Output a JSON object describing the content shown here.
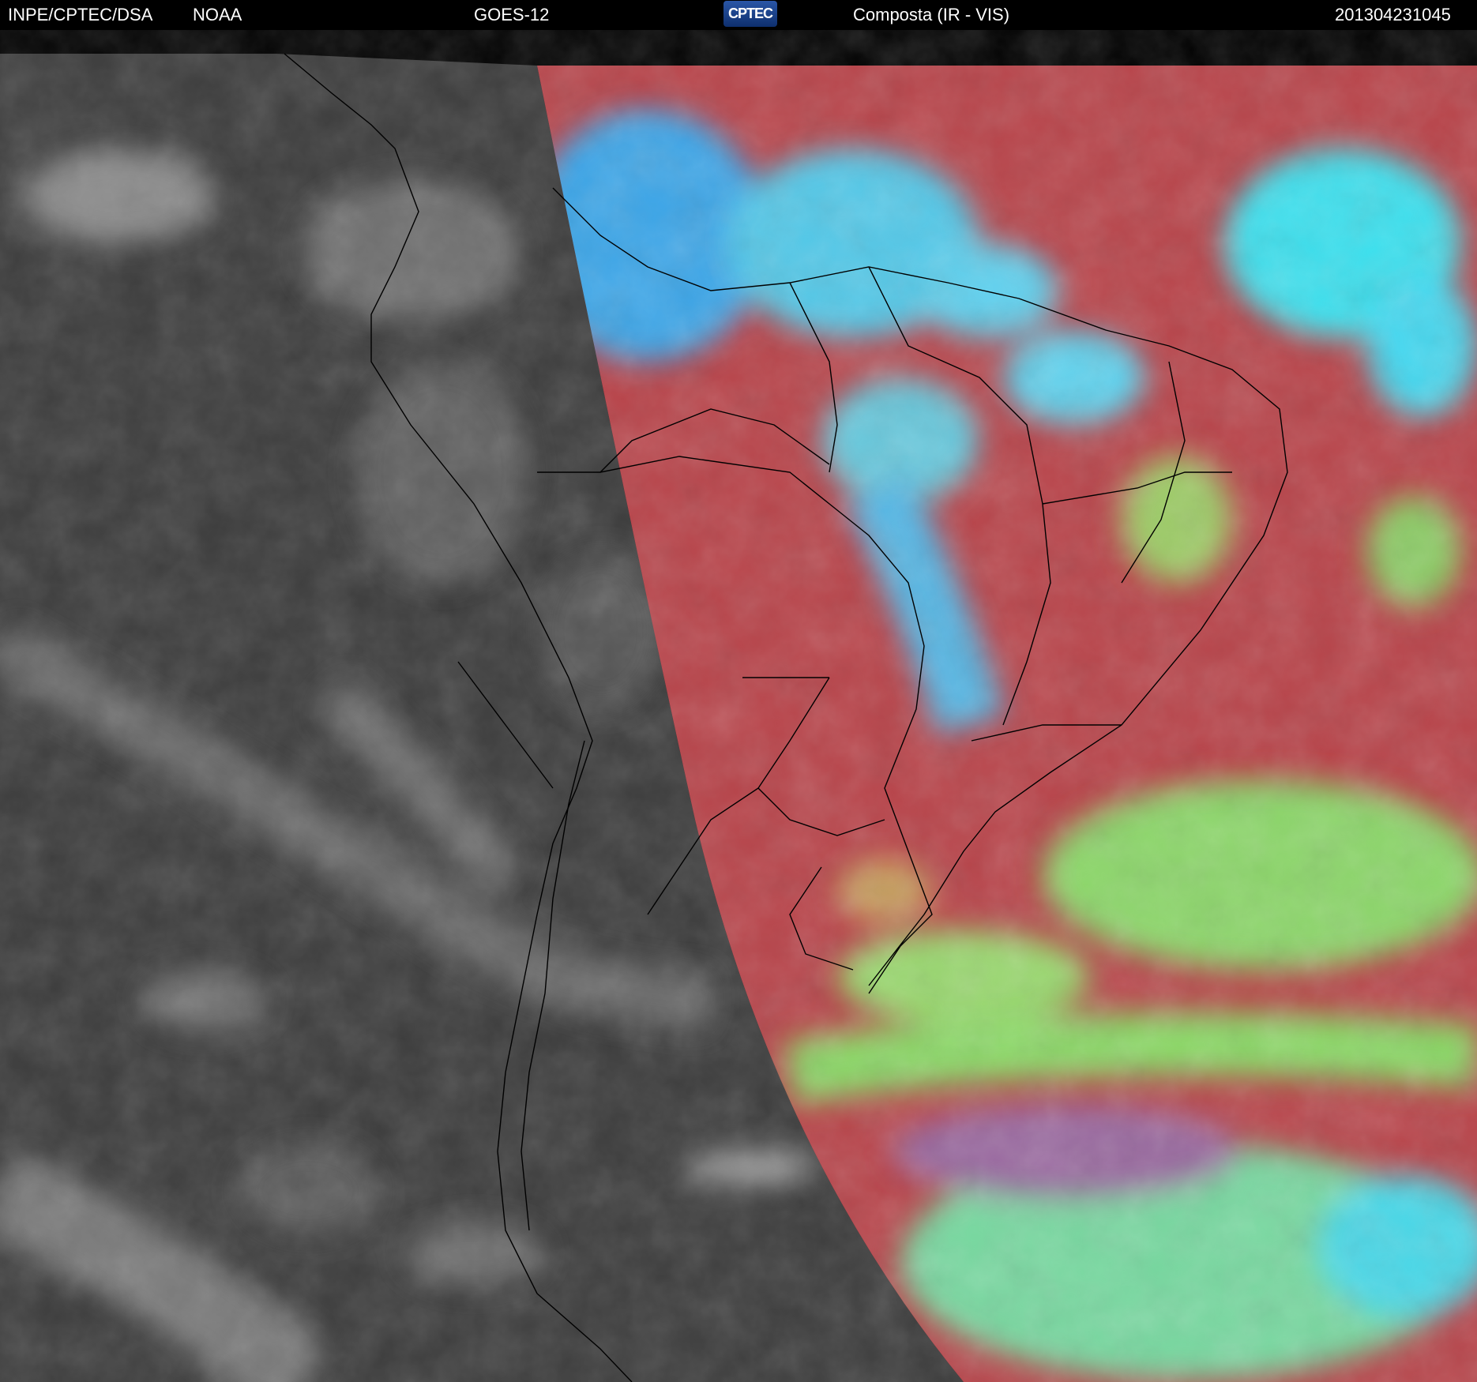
{
  "header": {
    "agency": "INPE/CPTEC/DSA",
    "partner": "NOAA",
    "satellite": "GOES-12",
    "logo_text": "CPTEC",
    "product": "Composta (IR - VIS)",
    "timestamp": "201304231045"
  },
  "colors": {
    "night_side": "#3c3c3c",
    "day_side": "#b8444a",
    "high_cloud": "#3ed8f0",
    "low_cloud": "#8fe070",
    "border_lines": "#000000"
  }
}
